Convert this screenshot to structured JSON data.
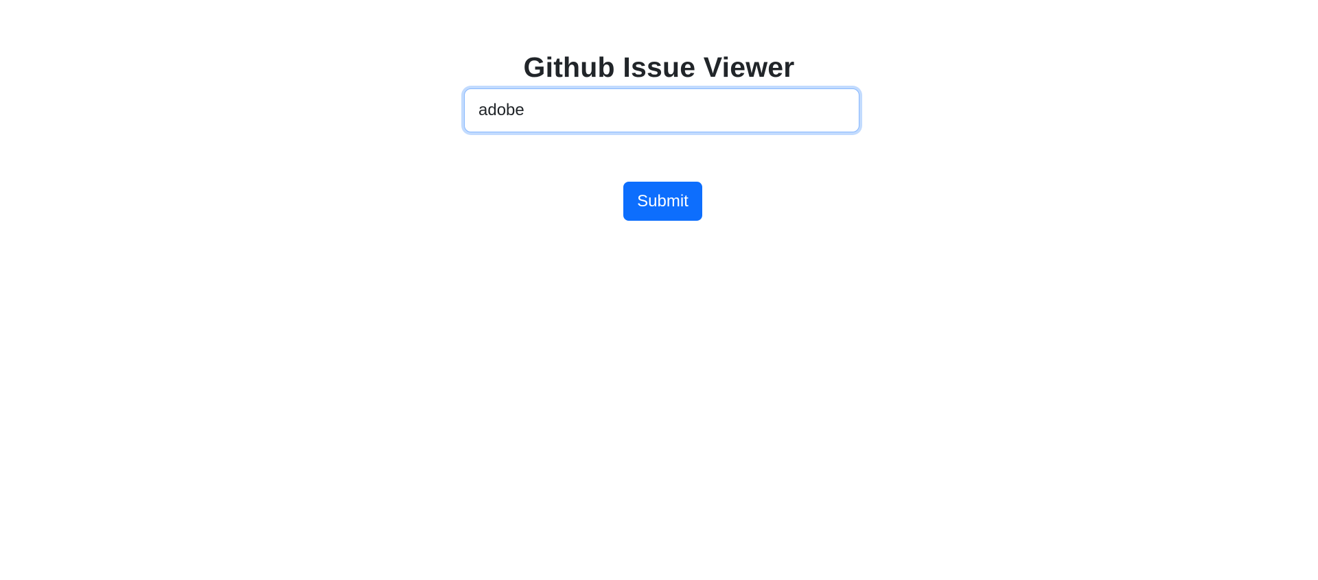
{
  "header": {
    "title": "Github Issue Viewer"
  },
  "search": {
    "value": "adobe",
    "placeholder": ""
  },
  "form": {
    "submit_label": "Submit"
  },
  "colors": {
    "primary": "#0d6efd",
    "focus_border": "#86b7fe",
    "text": "#212529",
    "background": "#ffffff"
  }
}
